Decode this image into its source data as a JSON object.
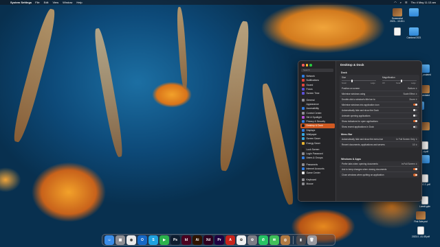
{
  "menubar": {
    "app_name": "System Settings",
    "menus": [
      "File",
      "Edit",
      "View",
      "Window",
      "Help"
    ],
    "clock": "Thu 4 May  11:13 am"
  },
  "desktop_icons": [
    {
      "label": "Screenshot 2023-...10.45.1",
      "kind": "thumb"
    },
    {
      "label": "",
      "kind": "folder"
    },
    {
      "label": "",
      "kind": "doc"
    },
    {
      "label": "Cardonal 2021",
      "kind": "folder"
    },
    {
      "label": "...x_undated",
      "kind": "folder"
    },
    {
      "label": "...undated",
      "kind": "thumb"
    },
    {
      "label": "",
      "kind": "folder"
    },
    {
      "label": "",
      "kind": "thumb"
    },
    {
      "label": "...d.pdf",
      "kind": "doc"
    },
    {
      "label": "",
      "kind": "folder"
    },
    {
      "label": "LSG 2 .pdf",
      "kind": "doc"
    },
    {
      "label": "Lumdt.pptx",
      "kind": "doc"
    },
    {
      "label": "Fink Sale.psd",
      "kind": "thumb"
    },
    {
      "label": "2023-0...41.45 pdf",
      "kind": "doc"
    }
  ],
  "settings": {
    "window_title": "Desktop & Dock",
    "search_placeholder": "Search",
    "sidebar": [
      {
        "label": "Network",
        "color": "#2f7de1"
      },
      {
        "label": "Notifications",
        "color": "#e0443a"
      },
      {
        "label": "Sound",
        "color": "#e0443a"
      },
      {
        "label": "Focus",
        "color": "#5b4fd6"
      },
      {
        "label": "Screen Time",
        "color": "#5b4fd6"
      },
      {
        "label": "General",
        "color": "#8e8e93"
      },
      {
        "label": "Appearance",
        "color": "#1c1c1e"
      },
      {
        "label": "Accessibility",
        "color": "#2f7de1"
      },
      {
        "label": "Control Centre",
        "color": "#8e8e93"
      },
      {
        "label": "Siri & Spotlight",
        "color": "#b44fd6"
      },
      {
        "label": "Privacy & Security",
        "color": "#2f7de1"
      },
      {
        "label": "Desktop & Dock",
        "color": "#1c1c1e",
        "active": true
      },
      {
        "label": "Displays",
        "color": "#2f7de1"
      },
      {
        "label": "Wallpaper",
        "color": "#35a7e0"
      },
      {
        "label": "Screen Saver",
        "color": "#35a7e0"
      },
      {
        "label": "Energy Saver",
        "color": "#e8b431"
      },
      {
        "label": "Lock Screen",
        "color": "#1c1c1e"
      },
      {
        "label": "Login Password",
        "color": "#8e8e93"
      },
      {
        "label": "Users & Groups",
        "color": "#2f7de1"
      },
      {
        "label": "Passwords",
        "color": "#8e8e93"
      },
      {
        "label": "Internet Accounts",
        "color": "#2f7de1"
      },
      {
        "label": "Game Center",
        "color": "#e8e8e8"
      },
      {
        "label": "Keyboard",
        "color": "#8e8e93"
      },
      {
        "label": "Mouse",
        "color": "#8e8e93"
      }
    ],
    "dock": {
      "heading": "Dock",
      "size_label": "Size",
      "magnification_label": "Magnification",
      "size_ticks": [
        "Small",
        "Large"
      ],
      "mag_ticks": [
        "Off",
        "Small",
        "Large"
      ],
      "size_value": 0.3,
      "magnification_value": 0.55,
      "rows": [
        {
          "label": "Position on screen",
          "value": "Bottom",
          "type": "select"
        },
        {
          "label": "Minimise windows using",
          "value": "Scale Effect",
          "type": "select"
        },
        {
          "label": "Double-click a window's title bar to",
          "value": "Zoom",
          "type": "select"
        },
        {
          "label": "Minimise windows into application icon",
          "on": true,
          "type": "toggle"
        },
        {
          "label": "Automatically hide and show the Dock",
          "on": false,
          "type": "toggle"
        },
        {
          "label": "Animate opening applications",
          "on": false,
          "type": "toggle"
        },
        {
          "label": "Show indicators for open applications",
          "on": true,
          "type": "toggle"
        },
        {
          "label": "Show recent applications in Dock",
          "on": false,
          "type": "toggle"
        }
      ]
    },
    "menu_bar": {
      "heading": "Menu Bar",
      "rows": [
        {
          "label": "Automatically hide and show the menu bar",
          "value": "In Full Screen Only",
          "type": "select"
        },
        {
          "label": "Recent documents, applications and servers",
          "value": "10",
          "type": "select"
        }
      ]
    },
    "windows_apps": {
      "heading": "Windows & Apps",
      "rows": [
        {
          "label": "Prefer tabs when opening documents",
          "value": "In Full Screen",
          "type": "select"
        },
        {
          "label": "Ask to keep changes when closing documents",
          "on": true,
          "type": "toggle"
        },
        {
          "label": "Close windows when quitting an application",
          "on": true,
          "type": "toggle"
        }
      ]
    }
  },
  "dock_apps": [
    {
      "name": "finder",
      "glyph": "☺",
      "color": "#3a8de8"
    },
    {
      "name": "launchpad",
      "glyph": "▦",
      "color": "#8e8e93"
    },
    {
      "name": "chrome",
      "glyph": "◉",
      "color": "#e9e9e9"
    },
    {
      "name": "outlook",
      "glyph": "O",
      "color": "#1668c5"
    },
    {
      "name": "skype",
      "glyph": "S",
      "color": "#1fa2e0"
    },
    {
      "name": "facetime",
      "glyph": "▶",
      "color": "#2bb24c"
    },
    {
      "name": "photoshop",
      "glyph": "Ps",
      "color": "#0e1c2e"
    },
    {
      "name": "indesign",
      "glyph": "Id",
      "color": "#49021f"
    },
    {
      "name": "illustrator",
      "glyph": "Ai",
      "color": "#2d1300"
    },
    {
      "name": "xd",
      "glyph": "Xd",
      "color": "#2e001f"
    },
    {
      "name": "premiere",
      "glyph": "Pr",
      "color": "#1f0040"
    },
    {
      "name": "acrobat",
      "glyph": "A",
      "color": "#c7241c"
    },
    {
      "name": "photos",
      "glyph": "✿",
      "color": "#f0f0f0"
    },
    {
      "name": "system-settings",
      "glyph": "⚙",
      "color": "#7d7d85"
    },
    {
      "name": "whatsapp",
      "glyph": "✆",
      "color": "#25c363"
    },
    {
      "name": "messages",
      "glyph": "✉",
      "color": "#3fbf58"
    },
    {
      "name": "app-store",
      "glyph": "◎",
      "color": "#b07a42"
    },
    {
      "name": "downloads",
      "glyph": "▮",
      "color": "#4a4a50"
    },
    {
      "name": "trash",
      "glyph": "🗑",
      "color": "#9a9aa0"
    }
  ]
}
